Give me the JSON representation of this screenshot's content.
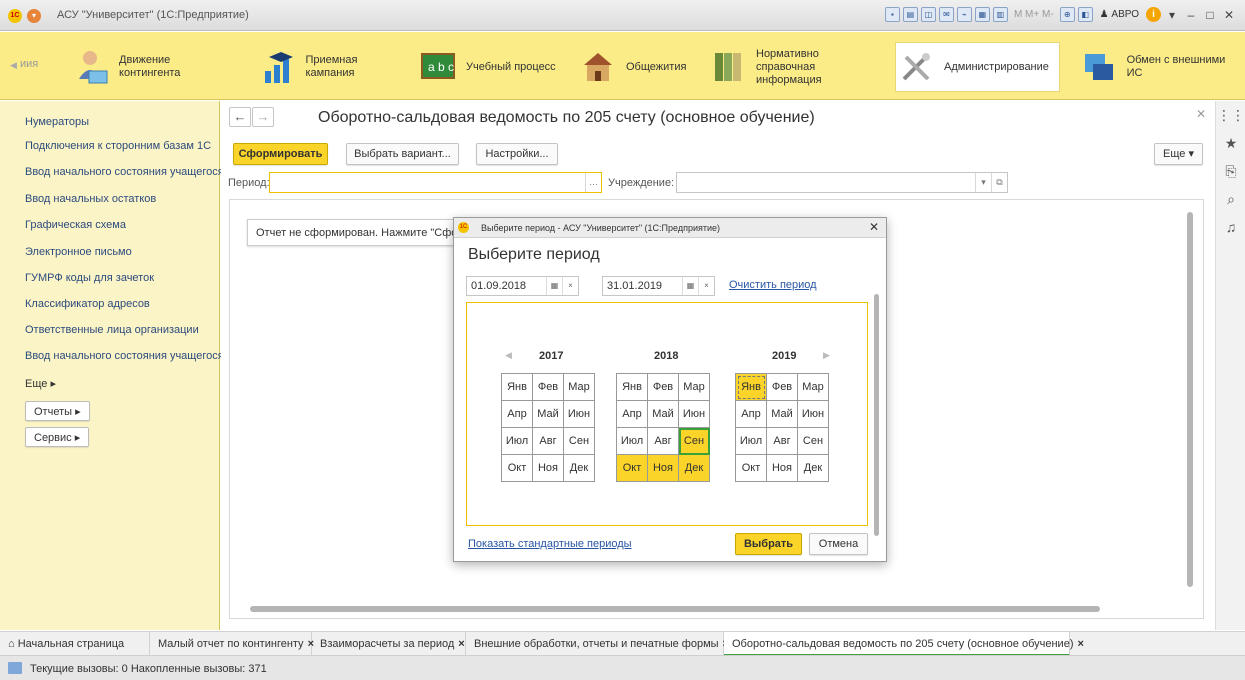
{
  "app": {
    "title": "АСУ \"Университет\" (1С:Предприятие)",
    "user": "АВРО"
  },
  "sections": {
    "clipped_label": "иия",
    "items": [
      {
        "label": "Движение контингента",
        "icon": "student-card-icon"
      },
      {
        "label": "Приемная кампания",
        "icon": "graduation-chart-icon"
      },
      {
        "label": "Учебный процесс",
        "icon": "abc-board-icon"
      },
      {
        "label": "Общежития",
        "icon": "dormitory-house-icon"
      },
      {
        "label": "Нормативно справочная информация",
        "icon": "binders-icon"
      },
      {
        "label": "Администрирование",
        "icon": "tools-icon"
      },
      {
        "label": "Обмен с внешними ИС",
        "icon": "data-exchange-icon"
      }
    ]
  },
  "leftnav": {
    "items": [
      "Нумераторы",
      "Подключения к сторонним базам 1С",
      "Ввод начального состояния учащегося",
      "Ввод начальных остатков",
      "Графическая схема",
      "Электронное письмо",
      "ГУМРФ коды для зачеток",
      "Классификатор адресов",
      "Ответственные лица организации",
      "Ввод начального состояния учащегося"
    ],
    "more": "Еще",
    "groups": [
      "Отчеты",
      "Сервис"
    ]
  },
  "form": {
    "title": "Оборотно-сальдовая ведомость по 205 счету (основное обучение)",
    "generate_btn": "Сформировать",
    "variant_btn": "Выбрать вариант...",
    "settings_btn": "Настройки...",
    "more_btn": "Еще",
    "period_label": "Период:",
    "period_value": "",
    "org_label": "Учреждение:",
    "org_value": "",
    "report_message": "Отчет не сформирован. Нажмите \"Сформировать\""
  },
  "dialog": {
    "window_title": "Выберите период - АСУ \"Университет\" (1С:Предприятие)",
    "title": "Выберите период",
    "date_from": "01.09.2018",
    "date_to": "31.01.2019",
    "clear_link": "Очистить период",
    "years": [
      {
        "year": "2017",
        "months": [
          "Янв",
          "Фев",
          "Мар",
          "Апр",
          "Май",
          "Июн",
          "Июл",
          "Авг",
          "Сен",
          "Окт",
          "Ноя",
          "Дек"
        ]
      },
      {
        "year": "2018",
        "months": [
          "Янв",
          "Фев",
          "Мар",
          "Апр",
          "Май",
          "Июн",
          "Июл",
          "Авг",
          "Сен",
          "Окт",
          "Ноя",
          "Дек"
        ]
      },
      {
        "year": "2019",
        "months": [
          "Янв",
          "Фев",
          "Мар",
          "Апр",
          "Май",
          "Июн",
          "Июл",
          "Авг",
          "Сен",
          "Окт",
          "Ноя",
          "Дек"
        ]
      }
    ],
    "selected_months": {
      "2018": [
        "Сен",
        "Окт",
        "Ноя",
        "Дек"
      ],
      "2019": [
        "Янв"
      ]
    },
    "standard_periods_link": "Показать стандартные периоды",
    "ok_btn": "Выбрать",
    "cancel_btn": "Отмена"
  },
  "tabs": {
    "home": "Начальная страница",
    "items": [
      "Малый отчет по контингенту",
      "Взаиморасчеты за период",
      "Внешние обработки, отчеты и печатные формы",
      "Оборотно-сальдовая ведомость по 205 счету (основное обучение)"
    ]
  },
  "status": {
    "text": "Текущие вызовы: 0   Накопленные вызовы: 371"
  },
  "colors": {
    "section_bg": "#fbec88",
    "nav_bg": "#fbf4c6",
    "accent": "#fbd429",
    "link": "#2855a3",
    "current_month": "#3aa03a"
  }
}
